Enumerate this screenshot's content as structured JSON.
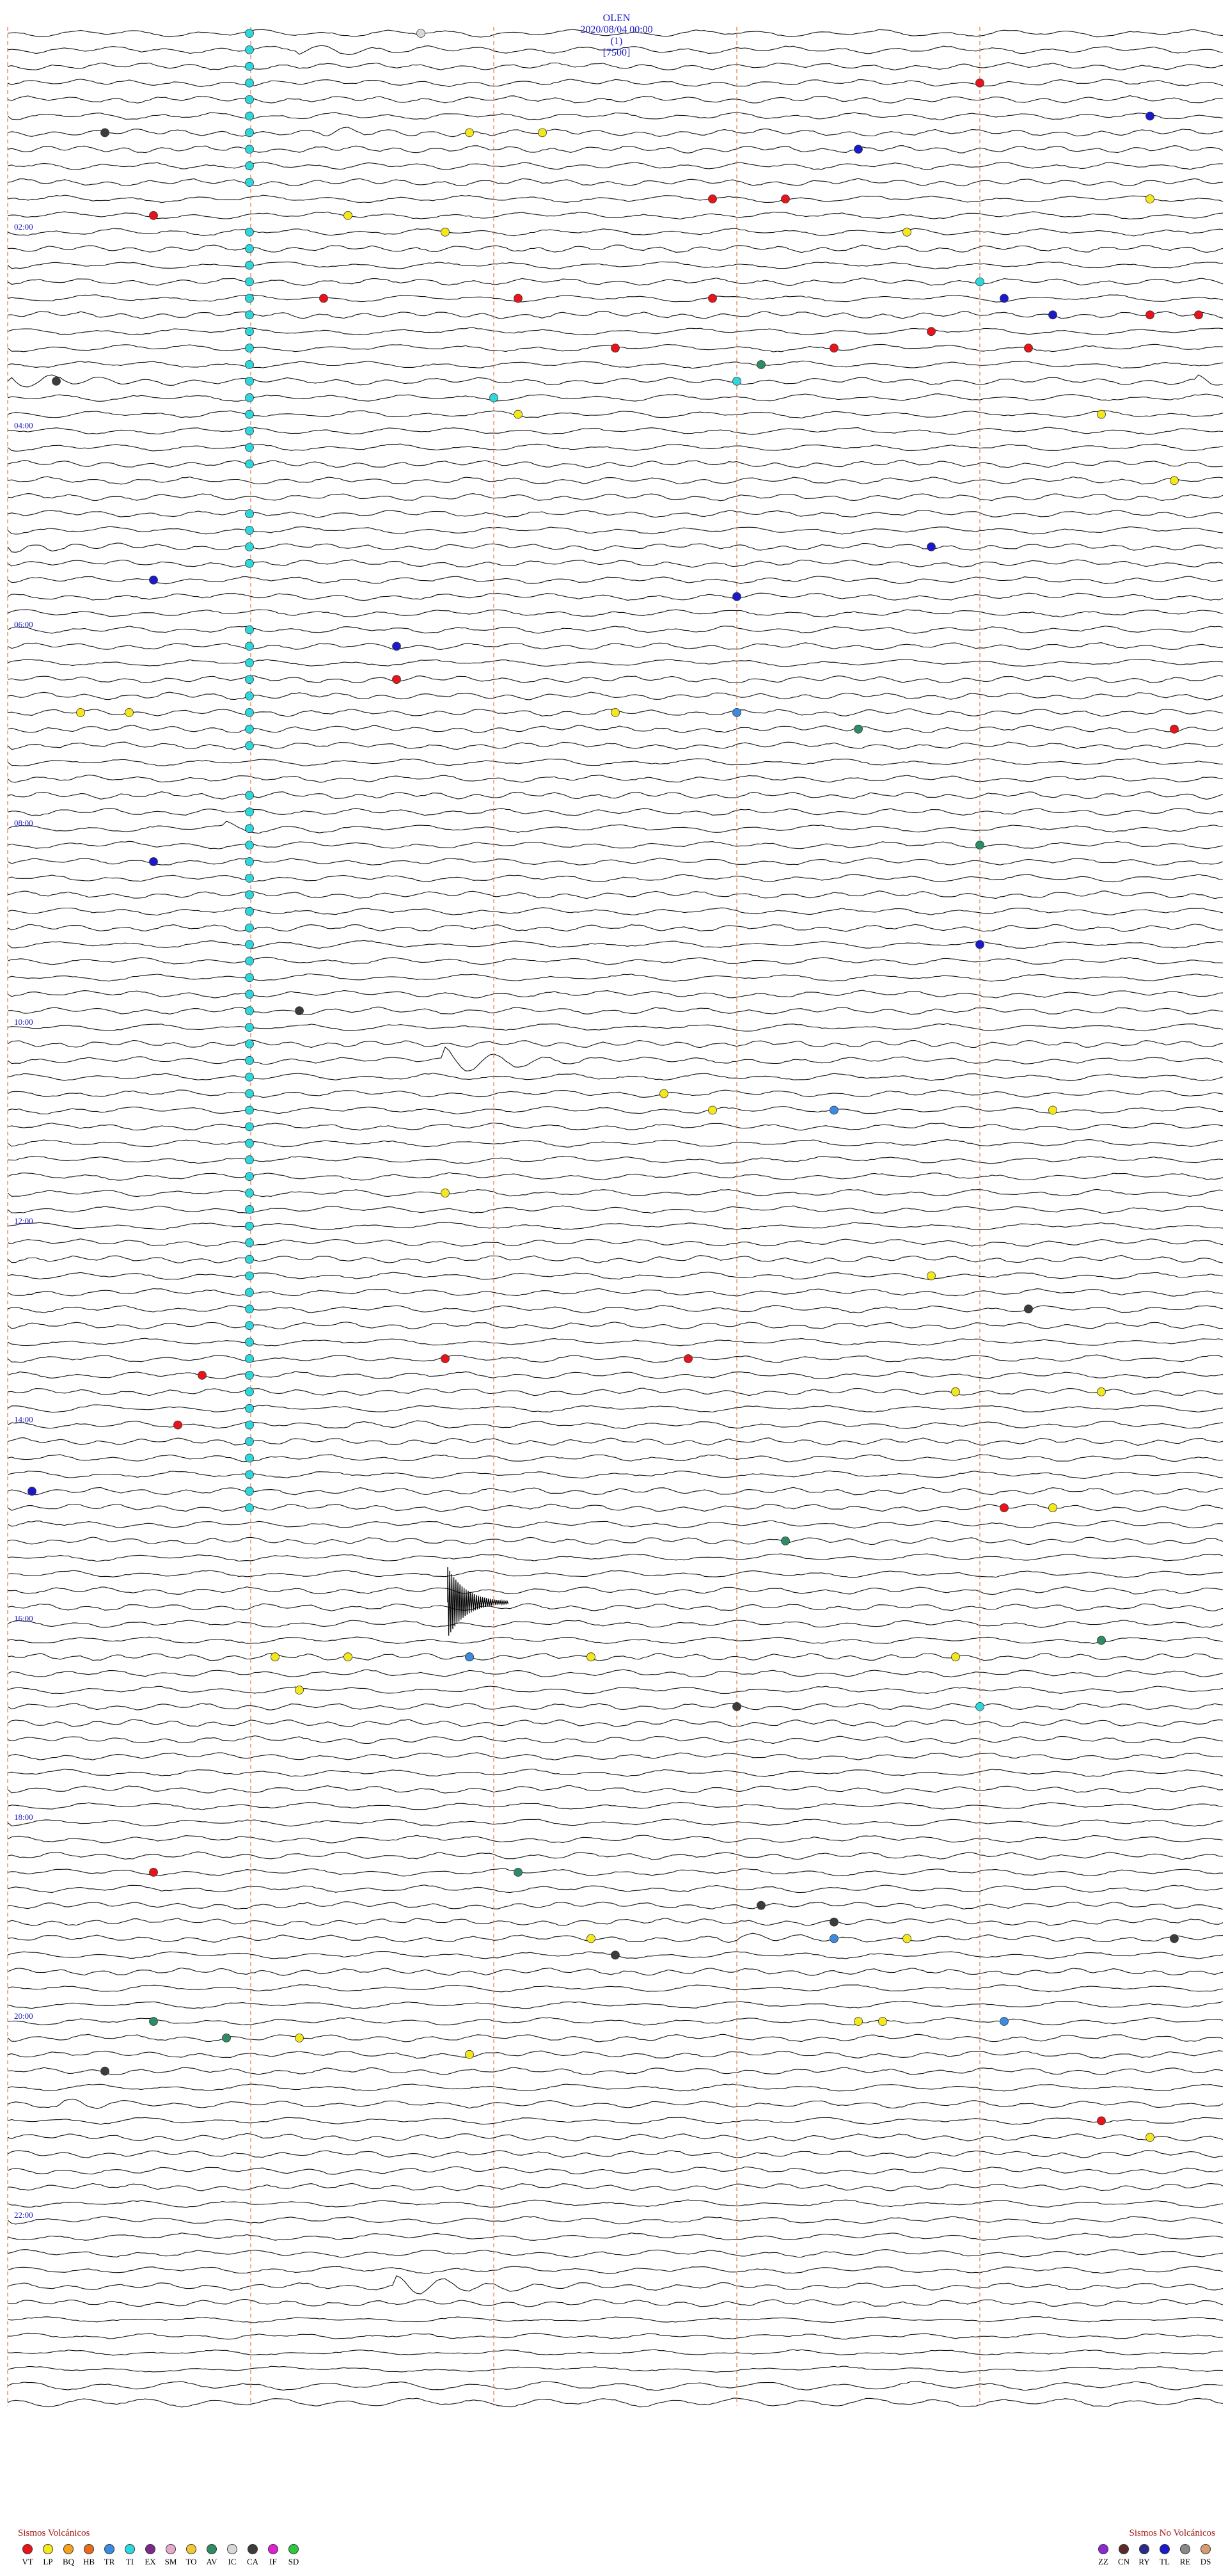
{
  "header": {
    "station": "OLEN",
    "datetime": "2020/08/04 00:00",
    "channel": "(1)",
    "gain": "[7500]"
  },
  "hour_labels": [
    "02:00",
    "04:00",
    "06:00",
    "08:00",
    "10:00",
    "12:00",
    "14:00",
    "16:00",
    "18:00",
    "20:00",
    "22:00"
  ],
  "legend_volcanic": {
    "title": "Sismos Volcánicos",
    "items": [
      {
        "code": "VT",
        "color": "#e8141a"
      },
      {
        "code": "LP",
        "color": "#f4e81c"
      },
      {
        "code": "BQ",
        "color": "#f6a21a"
      },
      {
        "code": "HB",
        "color": "#e86a1a"
      },
      {
        "code": "TR",
        "color": "#3b8ce0"
      },
      {
        "code": "TI",
        "color": "#2cd8dc"
      },
      {
        "code": "EX",
        "color": "#7a2a8c"
      },
      {
        "code": "SM",
        "color": "#e8a8cc"
      },
      {
        "code": "TO",
        "color": "#f0c832"
      },
      {
        "code": "AV",
        "color": "#2e8c64"
      },
      {
        "code": "IC",
        "color": "#d8d8d8"
      },
      {
        "code": "CA",
        "color": "#3c3c3c"
      },
      {
        "code": "IF",
        "color": "#e020d0"
      },
      {
        "code": "SD",
        "color": "#2ec840"
      }
    ]
  },
  "legend_nonvolcanic": {
    "title": "Sismos No Volcánicos",
    "items": [
      {
        "code": "ZZ",
        "color": "#8a2ad0"
      },
      {
        "code": "CN",
        "color": "#5a2a2a"
      },
      {
        "code": "RY",
        "color": "#2a2a8c"
      },
      {
        "code": "TL",
        "color": "#1a1acc"
      },
      {
        "code": "RE",
        "color": "#888888"
      },
      {
        "code": "DS",
        "color": "#d89a70"
      }
    ]
  },
  "chart_data": {
    "type": "line",
    "title": "",
    "xlabel": "",
    "ylabel": "",
    "description_units": "helicorder traces, one per 10 minutes",
    "traces_per_hour": 6,
    "total_traces": 144,
    "time_marker_minutes": [
      10,
      20,
      30,
      40
    ],
    "events": [
      {
        "trace": 0,
        "minute": 17,
        "type": "IC"
      },
      {
        "trace": 3,
        "minute": 40,
        "type": "VT"
      },
      {
        "trace": 5,
        "minute": 47,
        "type": "TL"
      },
      {
        "trace": 6,
        "minute": 4,
        "type": "CA"
      },
      {
        "trace": 6,
        "minute": 19,
        "type": "LP"
      },
      {
        "trace": 6,
        "minute": 22,
        "type": "LP"
      },
      {
        "trace": 7,
        "minute": 35,
        "type": "TL"
      },
      {
        "trace": 10,
        "minute": 29,
        "type": "VT"
      },
      {
        "trace": 10,
        "minute": 32,
        "type": "VT"
      },
      {
        "trace": 10,
        "minute": 47,
        "type": "LP"
      },
      {
        "trace": 11,
        "minute": 6,
        "type": "VT"
      },
      {
        "trace": 11,
        "minute": 14,
        "type": "LP"
      },
      {
        "trace": 12,
        "minute": 37,
        "type": "LP"
      },
      {
        "trace": 12,
        "minute": 18,
        "type": "LP"
      },
      {
        "trace": 15,
        "minute": 40,
        "type": "TI"
      },
      {
        "trace": 16,
        "minute": 13,
        "type": "VT"
      },
      {
        "trace": 16,
        "minute": 21,
        "type": "VT"
      },
      {
        "trace": 16,
        "minute": 29,
        "type": "VT"
      },
      {
        "trace": 16,
        "minute": 41,
        "type": "TL"
      },
      {
        "trace": 17,
        "minute": 43,
        "type": "TL"
      },
      {
        "trace": 17,
        "minute": 47,
        "type": "VT"
      },
      {
        "trace": 17,
        "minute": 49,
        "type": "VT"
      },
      {
        "trace": 18,
        "minute": 38,
        "type": "VT"
      },
      {
        "trace": 19,
        "minute": 25,
        "type": "VT"
      },
      {
        "trace": 19,
        "minute": 34,
        "type": "VT"
      },
      {
        "trace": 19,
        "minute": 42,
        "type": "VT"
      },
      {
        "trace": 20,
        "minute": 31,
        "type": "AV"
      },
      {
        "trace": 21,
        "minute": 2,
        "type": "CA"
      },
      {
        "trace": 21,
        "minute": 30,
        "type": "TI"
      },
      {
        "trace": 22,
        "minute": 20,
        "type": "TI"
      },
      {
        "trace": 23,
        "minute": 21,
        "type": "LP"
      },
      {
        "trace": 23,
        "minute": 45,
        "type": "LP"
      },
      {
        "trace": 27,
        "minute": 48,
        "type": "LP"
      },
      {
        "trace": 31,
        "minute": 38,
        "type": "TL"
      },
      {
        "trace": 33,
        "minute": 6,
        "type": "TL"
      },
      {
        "trace": 34,
        "minute": 30,
        "type": "TL"
      },
      {
        "trace": 37,
        "minute": 16,
        "type": "TL"
      },
      {
        "trace": 39,
        "minute": 16,
        "type": "VT"
      },
      {
        "trace": 41,
        "minute": 3,
        "type": "LP"
      },
      {
        "trace": 41,
        "minute": 5,
        "type": "LP"
      },
      {
        "trace": 41,
        "minute": 25,
        "type": "LP"
      },
      {
        "trace": 41,
        "minute": 30,
        "type": "TR"
      },
      {
        "trace": 42,
        "minute": 48,
        "type": "VT"
      },
      {
        "trace": 42,
        "minute": 35,
        "type": "AV"
      },
      {
        "trace": 49,
        "minute": 40,
        "type": "AV"
      },
      {
        "trace": 50,
        "minute": 6,
        "type": "TL"
      },
      {
        "trace": 55,
        "minute": 40,
        "type": "TL"
      },
      {
        "trace": 59,
        "minute": 12,
        "type": "CA"
      },
      {
        "trace": 64,
        "minute": 27,
        "type": "LP"
      },
      {
        "trace": 65,
        "minute": 29,
        "type": "LP"
      },
      {
        "trace": 65,
        "minute": 34,
        "type": "TR"
      },
      {
        "trace": 65,
        "minute": 43,
        "type": "LP"
      },
      {
        "trace": 70,
        "minute": 18,
        "type": "LP"
      },
      {
        "trace": 75,
        "minute": 38,
        "type": "LP"
      },
      {
        "trace": 77,
        "minute": 42,
        "type": "CA"
      },
      {
        "trace": 80,
        "minute": 18,
        "type": "VT"
      },
      {
        "trace": 80,
        "minute": 28,
        "type": "VT"
      },
      {
        "trace": 81,
        "minute": 8,
        "type": "VT"
      },
      {
        "trace": 82,
        "minute": 39,
        "type": "LP"
      },
      {
        "trace": 82,
        "minute": 45,
        "type": "LP"
      },
      {
        "trace": 84,
        "minute": 7,
        "type": "VT"
      },
      {
        "trace": 88,
        "minute": 1,
        "type": "TL"
      },
      {
        "trace": 89,
        "minute": 41,
        "type": "VT"
      },
      {
        "trace": 89,
        "minute": 43,
        "type": "LP"
      },
      {
        "trace": 91,
        "minute": 32,
        "type": "AV"
      },
      {
        "trace": 97,
        "minute": 45,
        "type": "AV"
      },
      {
        "trace": 98,
        "minute": 11,
        "type": "LP"
      },
      {
        "trace": 98,
        "minute": 14,
        "type": "LP"
      },
      {
        "trace": 98,
        "minute": 19,
        "type": "LP"
      },
      {
        "trace": 98,
        "minute": 19,
        "type": "TR"
      },
      {
        "trace": 98,
        "minute": 24,
        "type": "LP"
      },
      {
        "trace": 98,
        "minute": 39,
        "type": "LP"
      },
      {
        "trace": 100,
        "minute": 12,
        "type": "LP"
      },
      {
        "trace": 101,
        "minute": 30,
        "type": "CA"
      },
      {
        "trace": 101,
        "minute": 40,
        "type": "TI"
      },
      {
        "trace": 111,
        "minute": 6,
        "type": "VT"
      },
      {
        "trace": 111,
        "minute": 21,
        "type": "AV"
      },
      {
        "trace": 113,
        "minute": 31,
        "type": "CA"
      },
      {
        "trace": 114,
        "minute": 34,
        "type": "CA"
      },
      {
        "trace": 115,
        "minute": 24,
        "type": "LP"
      },
      {
        "trace": 115,
        "minute": 34,
        "type": "TR"
      },
      {
        "trace": 115,
        "minute": 37,
        "type": "LP"
      },
      {
        "trace": 115,
        "minute": 48,
        "type": "CA"
      },
      {
        "trace": 116,
        "minute": 25,
        "type": "CA"
      },
      {
        "trace": 120,
        "minute": 6,
        "type": "AV"
      },
      {
        "trace": 120,
        "minute": 35,
        "type": "LP"
      },
      {
        "trace": 120,
        "minute": 36,
        "type": "LP"
      },
      {
        "trace": 120,
        "minute": 41,
        "type": "TR"
      },
      {
        "trace": 121,
        "minute": 9,
        "type": "AV"
      },
      {
        "trace": 121,
        "minute": 12,
        "type": "LP"
      },
      {
        "trace": 122,
        "minute": 19,
        "type": "LP"
      },
      {
        "trace": 123,
        "minute": 4,
        "type": "CA"
      },
      {
        "trace": 126,
        "minute": 45,
        "type": "VT"
      },
      {
        "trace": 127,
        "minute": 47,
        "type": "LP"
      }
    ]
  }
}
